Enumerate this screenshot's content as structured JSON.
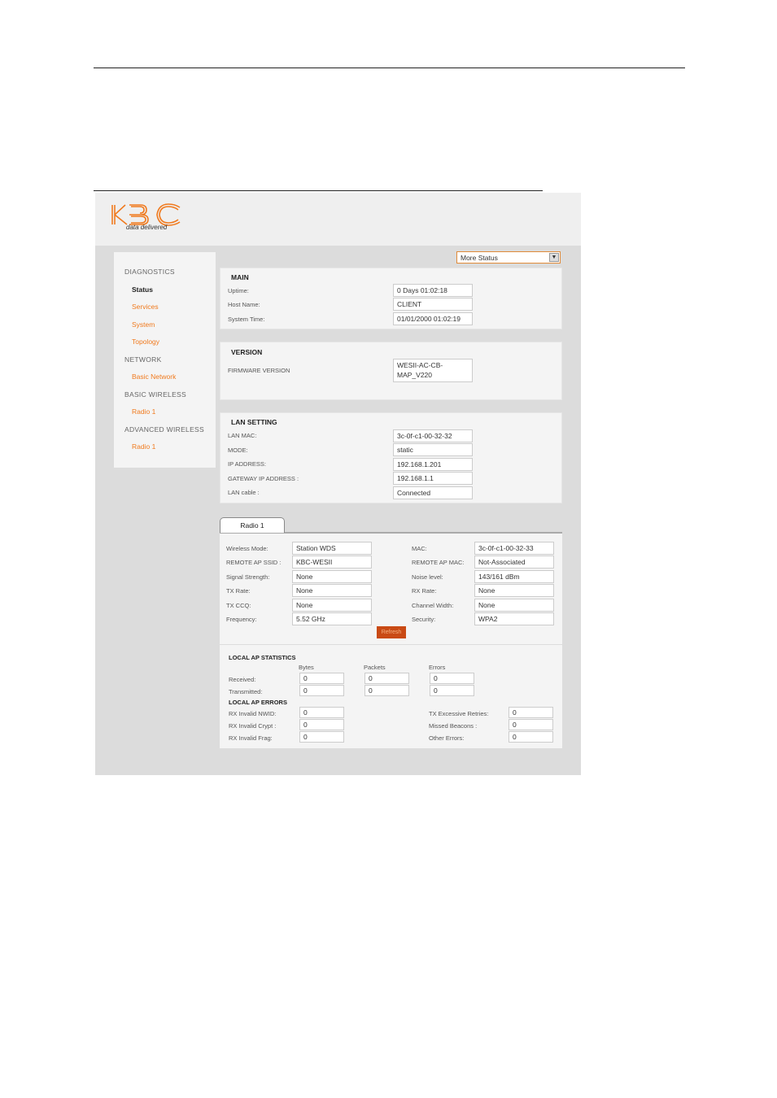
{
  "logo": {
    "text": "KBC",
    "tagline": "data delivered"
  },
  "sidebar": {
    "sections": [
      {
        "heading": "DIAGNOSTICS",
        "items": [
          "Status",
          "Services",
          "System",
          "Topology"
        ]
      },
      {
        "heading": "NETWORK",
        "items": [
          "Basic Network"
        ]
      },
      {
        "heading": "BASIC WIRELESS",
        "items": [
          "Radio 1"
        ]
      },
      {
        "heading": "ADVANCED WIRELESS",
        "items": [
          "Radio 1"
        ]
      }
    ],
    "active_item": "Status"
  },
  "status_select": {
    "value": "More Status"
  },
  "main": {
    "title": "MAIN",
    "rows": [
      {
        "label": "Uptime:",
        "value": "0 Days 01:02:18"
      },
      {
        "label": "Host Name:",
        "value": "CLIENT"
      },
      {
        "label": "System Time:",
        "value": "01/01/2000 01:02:19"
      }
    ]
  },
  "version": {
    "title": "VERSION",
    "label": "FIRMWARE VERSION",
    "value_line1": "WESII-AC-CB-",
    "value_line2": "MAP_V220"
  },
  "lan": {
    "title": "LAN SETTING",
    "rows": [
      {
        "label": "LAN MAC:",
        "value": "3c-0f-c1-00-32-32"
      },
      {
        "label": "MODE:",
        "value": "static"
      },
      {
        "label": "IP ADDRESS:",
        "value": "192.168.1.201"
      },
      {
        "label": "GATEWAY IP ADDRESS :",
        "value": "192.168.1.1"
      },
      {
        "label": "LAN cable :",
        "value": "Connected"
      }
    ]
  },
  "radio": {
    "tab_label": "Radio 1",
    "left": [
      {
        "label": "Wireless Mode:",
        "value": "Station WDS"
      },
      {
        "label": "REMOTE AP SSID :",
        "value": "KBC-WESII"
      },
      {
        "label": "Signal Strength:",
        "value": "None"
      },
      {
        "label": "TX Rate:",
        "value": "None"
      },
      {
        "label": "TX CCQ:",
        "value": "None"
      },
      {
        "label": "Frequency:",
        "value": "5.52 GHz"
      }
    ],
    "right": [
      {
        "label": "MAC:",
        "value": "3c-0f-c1-00-32-33"
      },
      {
        "label": "REMOTE AP MAC:",
        "value": "Not-Associated"
      },
      {
        "label": "Noise level:",
        "value": "143/161 dBm"
      },
      {
        "label": "RX Rate:",
        "value": "None"
      },
      {
        "label": "Channel Width:",
        "value": "None"
      },
      {
        "label": "Security:",
        "value": "WPA2"
      }
    ],
    "refresh_label": "Refresh"
  },
  "ap_stats": {
    "title": "LOCAL AP STATISTICS",
    "columns": [
      "Bytes",
      "Packets",
      "Errors"
    ],
    "rows": [
      {
        "label": "Received:",
        "values": [
          "0",
          "0",
          "0"
        ]
      },
      {
        "label": "Transmitted:",
        "values": [
          "0",
          "0",
          "0"
        ]
      }
    ]
  },
  "ap_errors": {
    "title": "LOCAL AP ERRORS",
    "left": [
      {
        "label": "RX Invalid NWID:",
        "value": "0"
      },
      {
        "label": "RX Invalid Crypt :",
        "value": "0"
      },
      {
        "label": "RX Invalid Frag:",
        "value": "0"
      }
    ],
    "right": [
      {
        "label": "TX Excessive Retries:",
        "value": "0"
      },
      {
        "label": "Missed Beacons :",
        "value": "0"
      },
      {
        "label": "Other Errors:",
        "value": "0"
      }
    ]
  },
  "colors": {
    "accent": "#f07a1e",
    "refresh_bg": "#c94a14",
    "page_bg": "#dcdcdc",
    "panel_bg": "#f4f4f4"
  }
}
